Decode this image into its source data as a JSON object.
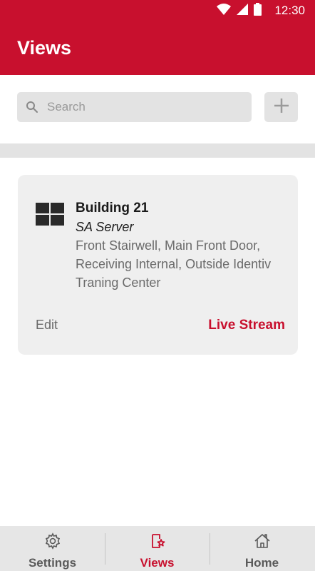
{
  "status_bar": {
    "time": "12:30",
    "icons": [
      "wifi-icon",
      "cell-signal-icon",
      "battery-icon"
    ]
  },
  "app_bar": {
    "title": "Views"
  },
  "search": {
    "placeholder": "Search",
    "value": ""
  },
  "add_button": {
    "icon": "plus-icon"
  },
  "views": [
    {
      "icon": "grid-icon",
      "title": "Building 21",
      "subtitle": "SA Server",
      "description": "Front Stairwell, Main Front Door, Receiving Internal, Outside Identiv Traning Center",
      "edit_label": "Edit",
      "live_label": "Live Stream"
    }
  ],
  "bottom_nav": {
    "items": [
      {
        "label": "Settings",
        "icon": "gear-icon",
        "active": false
      },
      {
        "label": "Views",
        "icon": "views-star-icon",
        "active": true
      },
      {
        "label": "Home",
        "icon": "home-icon",
        "active": false
      }
    ]
  },
  "colors": {
    "brand": "#c8102e",
    "surface": "#efefef",
    "control": "#e3e3e3"
  }
}
